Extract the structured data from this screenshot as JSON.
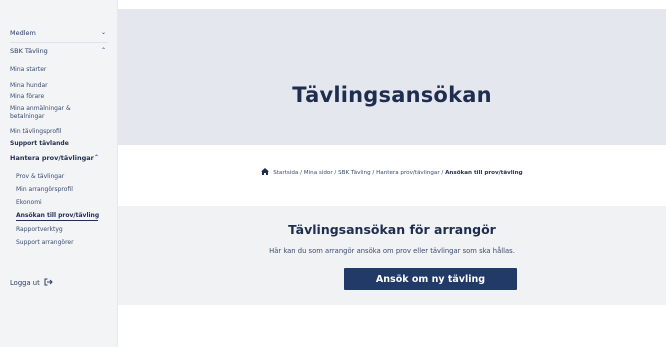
{
  "sidebar": {
    "sections": [
      {
        "label": "Medlem",
        "chevron": "chevron-down"
      },
      {
        "label": "SBK Tävling",
        "chevron": "chevron-up"
      }
    ],
    "items": [
      {
        "label": "Mina starter"
      },
      {
        "label": "Mina hundar"
      },
      {
        "label": "Mina förare"
      },
      {
        "label": "Mina anmälningar &"
      },
      {
        "label": "betalningar"
      },
      {
        "label": "Min tävlingsprofil"
      },
      {
        "label": "Support tävlande"
      },
      {
        "label": "Hantera prov/tävlingar"
      }
    ],
    "sub_items": [
      {
        "label": "Prov & tävlingar"
      },
      {
        "label": "Min arrangörsprofil"
      },
      {
        "label": "Ekonomi"
      },
      {
        "label": "Ansökan till prov/tävling"
      },
      {
        "label": "Rapportverktyg"
      },
      {
        "label": "Support arrangörer"
      }
    ],
    "logout_label": "Logga ut",
    "icons": {
      "logout": "logout-icon",
      "chevron_down": "chevron-down-icon",
      "chevron_up": "chevron-up-icon"
    }
  },
  "hero": {
    "title": "Tävlingsansökan"
  },
  "breadcrumb": {
    "items": [
      "Startsida",
      "Mina sidor",
      "SBK Tävling",
      "Hantera prov/tävlingar"
    ],
    "current": "Ansökan till prov/tävling",
    "separator": " / ",
    "icon": "home-icon"
  },
  "main": {
    "title": "Tävlingsansökan för arrangör",
    "description": "Här kan du som arrangör ansöka om prov eller tävlingar som ska hållas.",
    "button_label": "Ansök om ny tävling"
  },
  "colors": {
    "primary": "#223a68",
    "hero_bg": "#e4e8ee",
    "panel_bg": "#f1f2f4",
    "sidebar_bg": "#f3f4f6"
  }
}
